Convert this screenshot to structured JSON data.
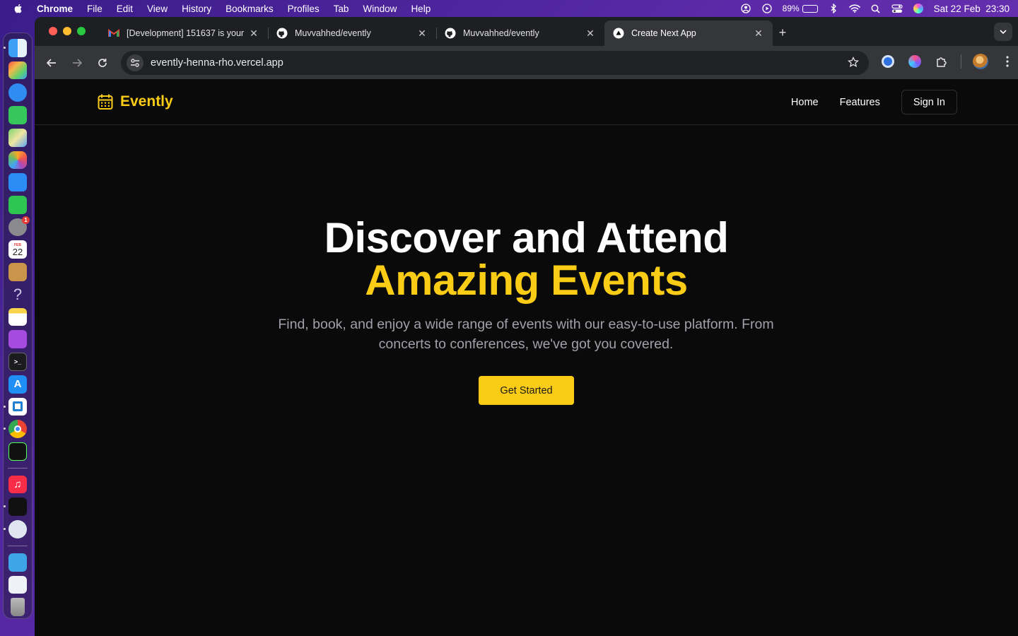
{
  "menubar": {
    "app": "Chrome",
    "items": [
      "File",
      "Edit",
      "View",
      "History",
      "Bookmarks",
      "Profiles",
      "Tab",
      "Window",
      "Help"
    ],
    "battery": "89%",
    "battery_level": 0.89,
    "datetime": "Sat 22 Feb  23:30"
  },
  "dock": {
    "calendar_day": "22",
    "calendar_month": "FEB",
    "settings_badge": "1",
    "apps": [
      "finder-icon",
      "launchpad-icon",
      "safari-icon",
      "messages-icon",
      "maps-icon",
      "photos-icon",
      "mail-icon",
      "facetime-icon",
      "system-settings-icon",
      "calendar-icon",
      "contacts-icon",
      "help-icon",
      "notes-icon",
      "podcasts-icon",
      "terminal-icon",
      "app-store-icon",
      "vscode-icon",
      "chrome-icon",
      "iterm-icon",
      "music-icon",
      "cursor-icon",
      "ai-app-icon",
      "downloads-folder-icon",
      "preview-icon",
      "trash-icon"
    ]
  },
  "browser": {
    "tabs": [
      {
        "title": "[Development] 151637 is your",
        "favicon": "gmail-icon",
        "active": false
      },
      {
        "title": "Muvvahhed/evently",
        "favicon": "github-icon",
        "active": false
      },
      {
        "title": "Muvvahhed/evently",
        "favicon": "github-icon",
        "active": false
      },
      {
        "title": "Create Next App",
        "favicon": "vercel-icon",
        "active": true
      }
    ],
    "url": "evently-henna-rho.vercel.app"
  },
  "site": {
    "brand": "Evently",
    "nav": {
      "home": "Home",
      "features": "Features",
      "signin": "Sign In"
    },
    "hero": {
      "line1": "Discover and Attend",
      "line2": "Amazing Events",
      "subtitle": "Find, book, and enjoy a wide range of events with our easy-to-use platform. From concerts to conferences, we've got you covered.",
      "cta": "Get Started"
    },
    "colors": {
      "accent": "#facc15",
      "background": "#0a0a0a",
      "muted_text": "#a1a1aa"
    }
  }
}
